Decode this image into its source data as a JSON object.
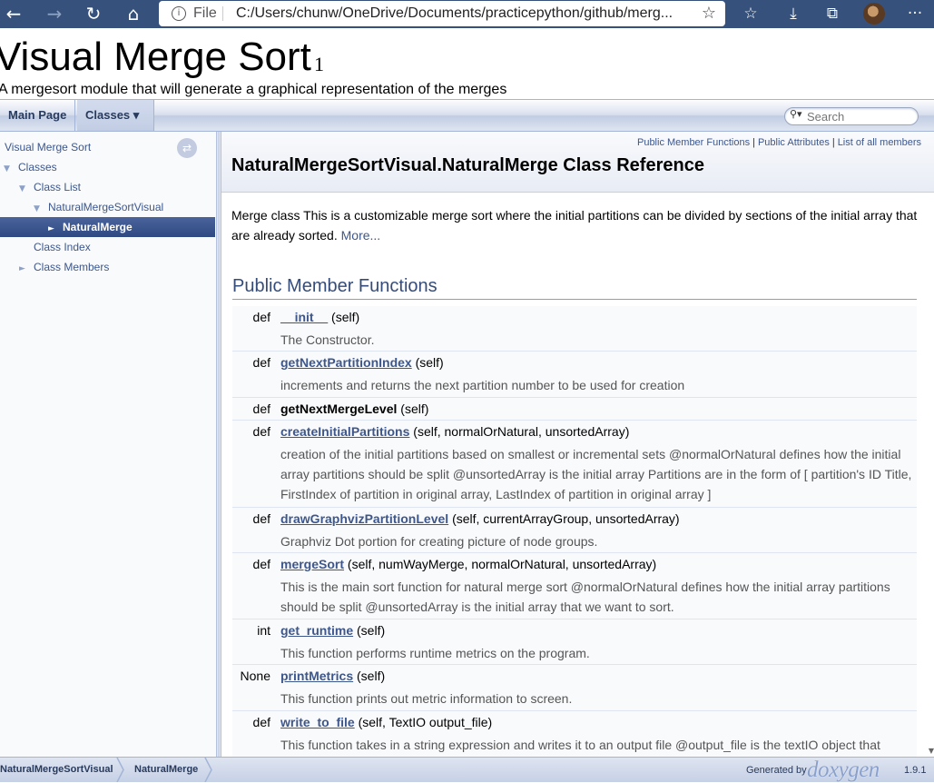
{
  "browser": {
    "back_icon": "←",
    "forward_icon": "→",
    "reload_icon": "↻",
    "home_icon": "⌂",
    "file_label": "File",
    "url": "C:/Users/chunw/OneDrive/Documents/practicepython/github/merg...",
    "toolbar": [
      "☆",
      "≡",
      "⤓",
      "⧉"
    ],
    "more_icon": "···"
  },
  "project": {
    "title": "Visual Merge Sort",
    "number": "1",
    "brief": "A mergesort module that will generate a graphical representation of the merges"
  },
  "tabs": {
    "main_page": "Main Page",
    "classes": "Classes ▾"
  },
  "search": {
    "placeholder": "Search"
  },
  "sidenav": {
    "items": [
      {
        "label": "Visual Merge Sort",
        "arrow": ""
      },
      {
        "label": "Classes",
        "arrow": "▼"
      },
      {
        "label": "Class List",
        "arrow": "▼"
      },
      {
        "label": "NaturalMergeSortVisual",
        "arrow": "▼"
      },
      {
        "label": "NaturalMerge",
        "arrow": "►"
      },
      {
        "label": "Class Index",
        "arrow": ""
      },
      {
        "label": "Class Members",
        "arrow": "►"
      }
    ],
    "sync_icon": "⇄"
  },
  "header": {
    "summary": [
      "Public Member Functions",
      "Public Attributes",
      "List of all members"
    ],
    "title": "NaturalMergeSortVisual.NaturalMerge Class Reference"
  },
  "brief": {
    "text": "Merge class This is a customizable merge sort where the initial partitions can be divided by sections of the initial array that are already sorted.",
    "more": "More..."
  },
  "section": {
    "title": "Public Member Functions"
  },
  "members": [
    {
      "type": "def",
      "name": "__init__",
      "args": "(self)",
      "linked": true,
      "desc": "The Constructor."
    },
    {
      "type": "def",
      "name": "getNextPartitionIndex",
      "args": "(self)",
      "linked": true,
      "desc": "increments and returns the next partition number to be used for creation"
    },
    {
      "type": "def",
      "name": "getNextMergeLevel",
      "args": "(self)",
      "linked": false,
      "desc": ""
    },
    {
      "type": "def",
      "name": "createInitialPartitions",
      "args": "(self, normalOrNatural, unsortedArray)",
      "linked": true,
      "desc": "creation of the initial partitions based on smallest or incremental sets @normalOrNatural defines how the initial array partitions should be split @unsortedArray is the initial array Partitions are in the form of [ partition's ID Title, FirstIndex of partition in original array, LastIndex of partition in original array ]"
    },
    {
      "type": "def",
      "name": "drawGraphvizPartitionLevel",
      "args": "(self, currentArrayGroup, unsortedArray)",
      "linked": true,
      "desc": "Graphviz Dot portion for creating picture of node groups."
    },
    {
      "type": "def",
      "name": "mergeSort",
      "args": "(self, numWayMerge, normalOrNatural, unsortedArray)",
      "linked": true,
      "desc": "This is the main sort function for natural merge sort @normalOrNatural defines how the initial array partitions should be split @unsortedArray is the initial array that we want to sort."
    },
    {
      "type": "int",
      "name": "get_runtime",
      "args": "(self)",
      "linked": true,
      "desc": "This function performs runtime metrics on the program."
    },
    {
      "type": "None",
      "name": "printMetrics",
      "args": "(self)",
      "linked": true,
      "desc": "This function prints out metric information to screen."
    },
    {
      "type": "def",
      "name": "write_to_file",
      "args": "(self, TextIO output_file)",
      "linked": true,
      "desc": "This function takes in a string expression and writes it to an output file @output_file is the textIO object that"
    }
  ],
  "footer": {
    "crumbs": [
      "NaturalMergeSortVisual",
      "NaturalMerge"
    ],
    "generated_by": "Generated by",
    "logo_text": "doxygen",
    "version": "1.9.1"
  }
}
